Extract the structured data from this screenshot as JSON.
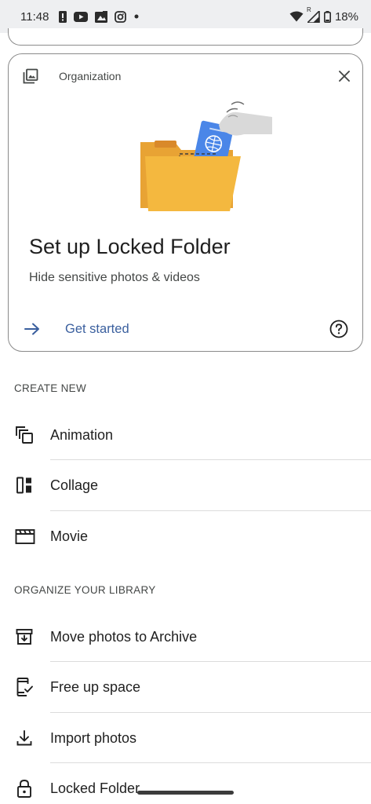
{
  "status_bar": {
    "time": "11:48",
    "battery": "18%",
    "notification_icons": [
      "alert-icon",
      "youtube-icon",
      "photos-gallery-icon",
      "instagram-icon",
      "dot-icon"
    ],
    "system_icons": [
      "wifi-icon",
      "signal-icon",
      "battery-icon"
    ],
    "signal_badge": "R"
  },
  "promo_card": {
    "kind_label": "Organization",
    "title": "Set up Locked Folder",
    "subtitle": "Hide sensitive photos & videos",
    "action_label": "Get started",
    "colors": {
      "folder": "#f4b83f",
      "folder_back": "#e8a334",
      "document": "#4a86e8",
      "hand": "#d9d9d9",
      "action": "#3a5f9e"
    }
  },
  "create_new": {
    "header": "CREATE NEW",
    "items": [
      {
        "label": "Animation",
        "icon": "animation-icon"
      },
      {
        "label": "Collage",
        "icon": "collage-icon"
      },
      {
        "label": "Movie",
        "icon": "movie-icon"
      }
    ]
  },
  "organize": {
    "header": "ORGANIZE YOUR LIBRARY",
    "items": [
      {
        "label": "Move photos to Archive",
        "icon": "archive-icon"
      },
      {
        "label": "Free up space",
        "icon": "phone-check-icon"
      },
      {
        "label": "Import photos",
        "icon": "download-icon"
      },
      {
        "label": "Locked Folder",
        "icon": "lock-icon"
      }
    ]
  }
}
